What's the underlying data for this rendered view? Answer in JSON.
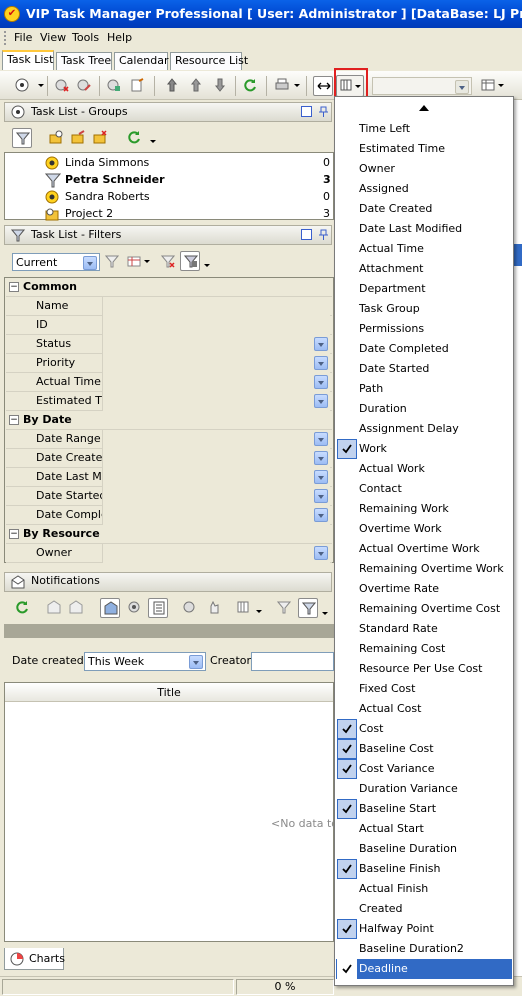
{
  "window": {
    "title": "VIP Task Manager Professional [ User: Administrator ] [DataBase: LJ Projects]"
  },
  "menu": [
    "File",
    "View",
    "Tools",
    "Help"
  ],
  "tabs": [
    "Task List",
    "Task Tree",
    "Calendar",
    "Resource List"
  ],
  "groups_panel": {
    "title": "Task List - Groups",
    "items": [
      {
        "label": "Linda Simmons",
        "count": "0",
        "bold": false
      },
      {
        "label": "Petra Schneider",
        "count": "3",
        "bold": true
      },
      {
        "label": "Sandra Roberts",
        "count": "0",
        "bold": false
      },
      {
        "label": "Project 2",
        "count": "3",
        "bold": false
      }
    ]
  },
  "filters_panel": {
    "title": "Task List - Filters",
    "filter_select": "Current",
    "categories": [
      {
        "label": "Common",
        "fields": [
          "Name",
          "ID",
          "Status",
          "Priority",
          "Actual Time",
          "Estimated Tir"
        ]
      },
      {
        "label": "By Date",
        "fields": [
          "Date Range",
          "Date Createc",
          "Date Last Mc",
          "Date Started",
          "Date Comple"
        ]
      },
      {
        "label": "By Resource",
        "fields": [
          "Owner"
        ]
      }
    ]
  },
  "notifications": {
    "title": "Notifications",
    "date_created_label": "Date created:",
    "date_created_value": "This Week",
    "creator_label": "Creator:",
    "column_title": "Title",
    "empty_text": "<No data to c"
  },
  "bottom_tab": "Charts",
  "status_progress": "0 %",
  "column_dropdown": {
    "items": [
      {
        "label": "Time Left",
        "checked": false
      },
      {
        "label": "Estimated Time",
        "checked": false
      },
      {
        "label": "Owner",
        "checked": false
      },
      {
        "label": "Assigned",
        "checked": false
      },
      {
        "label": "Date Created",
        "checked": false
      },
      {
        "label": "Date Last Modified",
        "checked": false
      },
      {
        "label": "Actual Time",
        "checked": false
      },
      {
        "label": "Attachment",
        "checked": false
      },
      {
        "label": "Department",
        "checked": false
      },
      {
        "label": "Task Group",
        "checked": false
      },
      {
        "label": "Permissions",
        "checked": false
      },
      {
        "label": "Date Completed",
        "checked": false
      },
      {
        "label": "Date Started",
        "checked": false
      },
      {
        "label": "Path",
        "checked": false
      },
      {
        "label": "Duration",
        "checked": false
      },
      {
        "label": "Assignment Delay",
        "checked": false
      },
      {
        "label": "Work",
        "checked": true
      },
      {
        "label": "Actual Work",
        "checked": false
      },
      {
        "label": "Contact",
        "checked": false
      },
      {
        "label": "Remaining Work",
        "checked": false
      },
      {
        "label": "Overtime Work",
        "checked": false
      },
      {
        "label": "Actual Overtime Work",
        "checked": false
      },
      {
        "label": "Remaining Overtime Work",
        "checked": false
      },
      {
        "label": "Overtime Rate",
        "checked": false
      },
      {
        "label": "Remaining Overtime Cost",
        "checked": false
      },
      {
        "label": "Standard Rate",
        "checked": false
      },
      {
        "label": "Remaining Cost",
        "checked": false
      },
      {
        "label": "Resource Per Use Cost",
        "checked": false
      },
      {
        "label": "Fixed Cost",
        "checked": false
      },
      {
        "label": "Actual Cost",
        "checked": false
      },
      {
        "label": "Cost",
        "checked": true
      },
      {
        "label": "Baseline Cost",
        "checked": true
      },
      {
        "label": "Cost Variance",
        "checked": true
      },
      {
        "label": "Duration Variance",
        "checked": false
      },
      {
        "label": "Baseline Start",
        "checked": true
      },
      {
        "label": "Actual Start",
        "checked": false
      },
      {
        "label": "Baseline Duration",
        "checked": false
      },
      {
        "label": "Baseline Finish",
        "checked": true
      },
      {
        "label": "Actual Finish",
        "checked": false
      },
      {
        "label": "Created",
        "checked": false
      },
      {
        "label": "Halfway Point",
        "checked": true
      },
      {
        "label": "Baseline Duration2",
        "checked": false
      },
      {
        "label": "Deadline",
        "checked": true,
        "selected": true
      }
    ]
  },
  "colors": {
    "titlebar": "#0054e3",
    "selection": "#316ac5",
    "highlight_border": "#e02020"
  }
}
